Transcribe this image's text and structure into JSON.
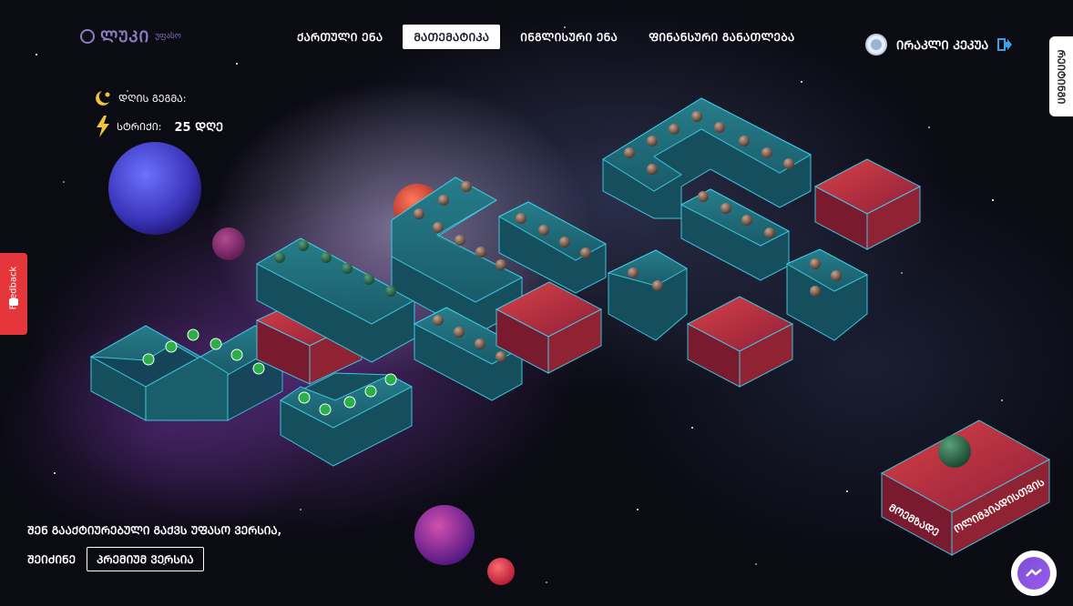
{
  "logo": {
    "text": "ᲚᲣᲙᲘ",
    "sub": "უფასო"
  },
  "nav": {
    "items": [
      {
        "label": "ᲥᲐᲠᲗᲣᲚᲘ ᲔᲜᲐ",
        "active": false
      },
      {
        "label": "ᲛᲐᲗᲔᲛᲐᲢᲘᲙᲐ",
        "active": true
      },
      {
        "label": "ᲘᲜᲒᲚᲘᲡᲣᲠᲘ ᲔᲜᲐ",
        "active": false
      },
      {
        "label": "ᲤᲘᲜᲐᲜᲡᲣᲠᲘ ᲒᲐᲜᲐᲗᲚᲔᲑᲐ",
        "active": false
      }
    ]
  },
  "user": {
    "name": "ᲘᲠᲐᲙᲚᲘ ᲙᲔᲙᲣᲐ"
  },
  "side_tab": {
    "label": "ᲠᲔᲘᲢᲘᲜᲒᲘ"
  },
  "feedback": {
    "label": "Feedback"
  },
  "stats": {
    "days_label": "ᲓᲦᲘᲡ ᲒᲔᲒᲛᲐ:",
    "bonus_label": "ᲡᲢᲠᲘᲥᲘ:",
    "bonus_value": "25 ᲓᲦᲔ"
  },
  "bottom": {
    "line1": "ᲨᲔᲜ ᲒᲐᲐᲥᲢᲘᲣᲠᲔᲑᲣᲚᲘ ᲒᲐᲥᲕᲡ ᲣᲤᲐᲡᲝ ᲕᲔᲠᲡᲘᲐ,",
    "line2": "ᲨᲔᲘᲫᲘᲜᲔ",
    "premium_button": "ᲞᲠᲔᲛᲘᲣᲛ ᲕᲔᲠᲡᲘᲐ"
  },
  "olympiad": {
    "word1": "ᲛᲝᲔᲛᲖᲐᲓᲔ",
    "word2": "ᲝᲚᲘᲛᲞᲘᲐᲓᲘᲡᲗᲕᲘᲡ"
  },
  "colors": {
    "accent": "#8d7dbf",
    "active_tab_bg": "#ffffff",
    "feedback": "#e5373b",
    "teal": "#1d6a7a",
    "red": "#c2343a"
  },
  "icons": {
    "logout": "logout-icon",
    "messenger": "messenger-icon",
    "moon": "moon-icon",
    "lightning": "lightning-icon"
  }
}
